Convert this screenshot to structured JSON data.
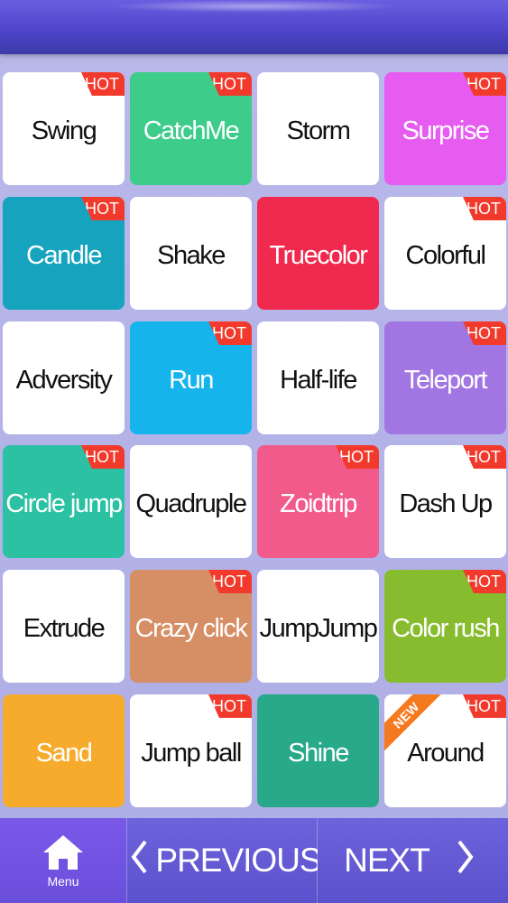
{
  "tiles": [
    {
      "label": "Swing",
      "hot": true,
      "new": false,
      "bg": "#ffffff",
      "theme": "light"
    },
    {
      "label": "CatchMe",
      "hot": true,
      "new": false,
      "bg": "#3dcc8a",
      "theme": "dark"
    },
    {
      "label": "Storm",
      "hot": false,
      "new": false,
      "bg": "#ffffff",
      "theme": "light"
    },
    {
      "label": "Surprise",
      "hot": true,
      "new": false,
      "bg": "#e75cf0",
      "theme": "dark"
    },
    {
      "label": "Candle",
      "hot": true,
      "new": false,
      "bg": "#16a3be",
      "theme": "dark"
    },
    {
      "label": "Shake",
      "hot": false,
      "new": false,
      "bg": "#ffffff",
      "theme": "light"
    },
    {
      "label": "Truecolor",
      "hot": false,
      "new": false,
      "bg": "#f0294e",
      "theme": "dark"
    },
    {
      "label": "Colorful",
      "hot": true,
      "new": false,
      "bg": "#ffffff",
      "theme": "light"
    },
    {
      "label": "Adversity",
      "hot": false,
      "new": false,
      "bg": "#ffffff",
      "theme": "light"
    },
    {
      "label": "Run",
      "hot": true,
      "new": false,
      "bg": "#15b4ec",
      "theme": "dark"
    },
    {
      "label": "Half-life",
      "hot": false,
      "new": false,
      "bg": "#ffffff",
      "theme": "light"
    },
    {
      "label": "Teleport",
      "hot": true,
      "new": false,
      "bg": "#a176e2",
      "theme": "dark"
    },
    {
      "label": "Circle jump",
      "hot": true,
      "new": false,
      "bg": "#2dc1a3",
      "theme": "dark"
    },
    {
      "label": "Quadruple",
      "hot": false,
      "new": false,
      "bg": "#ffffff",
      "theme": "light"
    },
    {
      "label": "Zoidtrip",
      "hot": true,
      "new": false,
      "bg": "#f25a8c",
      "theme": "dark"
    },
    {
      "label": "Dash Up",
      "hot": true,
      "new": false,
      "bg": "#ffffff",
      "theme": "light"
    },
    {
      "label": "Extrude",
      "hot": false,
      "new": false,
      "bg": "#ffffff",
      "theme": "light"
    },
    {
      "label": "Crazy click",
      "hot": true,
      "new": false,
      "bg": "#d68e64",
      "theme": "dark"
    },
    {
      "label": "JumpJump",
      "hot": false,
      "new": false,
      "bg": "#ffffff",
      "theme": "light"
    },
    {
      "label": "Color rush",
      "hot": true,
      "new": false,
      "bg": "#86bc2d",
      "theme": "dark"
    },
    {
      "label": "Sand",
      "hot": false,
      "new": false,
      "bg": "#f6ab2c",
      "theme": "dark"
    },
    {
      "label": "Jump ball",
      "hot": true,
      "new": false,
      "bg": "#ffffff",
      "theme": "light"
    },
    {
      "label": "Shine",
      "hot": false,
      "new": false,
      "bg": "#27a98a",
      "theme": "dark"
    },
    {
      "label": "Around",
      "hot": true,
      "new": true,
      "bg": "#ffffff",
      "theme": "light"
    }
  ],
  "badges": {
    "hot": "HOT",
    "new": "NEW"
  },
  "bottom": {
    "menu_label": "Menu",
    "menu_icon": "home-icon",
    "prev_label": "PREVIOUS",
    "next_label": "NEXT",
    "prev_icon": "chevron-left-icon",
    "next_icon": "chevron-right-icon"
  }
}
